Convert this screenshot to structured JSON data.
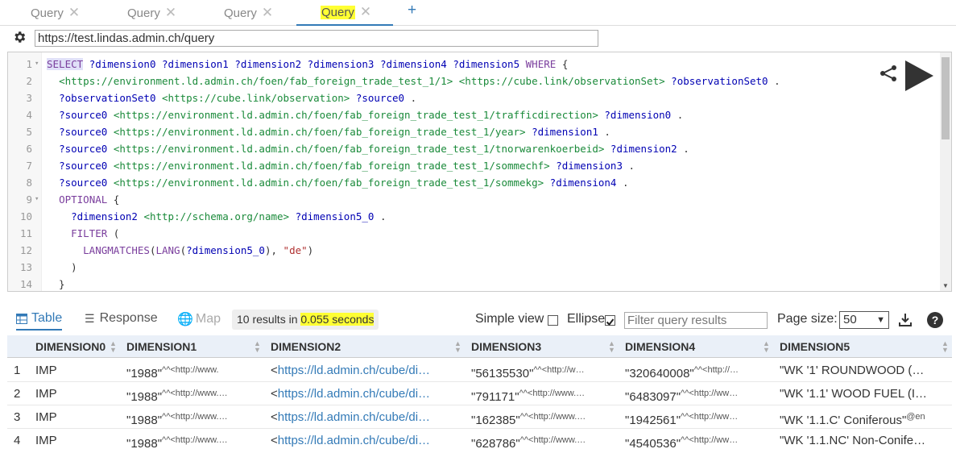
{
  "tabs": [
    {
      "label": "Query",
      "active": false
    },
    {
      "label": "Query",
      "active": false
    },
    {
      "label": "Query",
      "active": false
    },
    {
      "label": "Query",
      "active": true
    }
  ],
  "add_tab_label": "+",
  "endpoint_url": "https://test.lindas.admin.ch/query",
  "editor": {
    "lines": [
      {
        "n": "1",
        "fold": "▾",
        "text": "SELECT ?dimension0 ?dimension1 ?dimension2 ?dimension3 ?dimension4 ?dimension5 WHERE {"
      },
      {
        "n": "2",
        "fold": "",
        "text": "  <https://environment.ld.admin.ch/foen/fab_foreign_trade_test_1/1> <https://cube.link/observationSet> ?observationSet0 ."
      },
      {
        "n": "3",
        "fold": "",
        "text": "  ?observationSet0 <https://cube.link/observation> ?source0 ."
      },
      {
        "n": "4",
        "fold": "",
        "text": "  ?source0 <https://environment.ld.admin.ch/foen/fab_foreign_trade_test_1/trafficdirection> ?dimension0 ."
      },
      {
        "n": "5",
        "fold": "",
        "text": "  ?source0 <https://environment.ld.admin.ch/foen/fab_foreign_trade_test_1/year> ?dimension1 ."
      },
      {
        "n": "6",
        "fold": "",
        "text": "  ?source0 <https://environment.ld.admin.ch/foen/fab_foreign_trade_test_1/tnorwarenkoerbeid> ?dimension2 ."
      },
      {
        "n": "7",
        "fold": "",
        "text": "  ?source0 <https://environment.ld.admin.ch/foen/fab_foreign_trade_test_1/sommechf> ?dimension3 ."
      },
      {
        "n": "8",
        "fold": "",
        "text": "  ?source0 <https://environment.ld.admin.ch/foen/fab_foreign_trade_test_1/sommekg> ?dimension4 ."
      },
      {
        "n": "9",
        "fold": "▾",
        "text": "  OPTIONAL {"
      },
      {
        "n": "10",
        "fold": "",
        "text": "    ?dimension2 <http://schema.org/name> ?dimension5_0 ."
      },
      {
        "n": "11",
        "fold": "",
        "text": "    FILTER ("
      },
      {
        "n": "12",
        "fold": "",
        "text": "      LANGMATCHES(LANG(?dimension5_0), \"de\")"
      },
      {
        "n": "13",
        "fold": "",
        "text": "    )"
      },
      {
        "n": "14",
        "fold": "",
        "text": "  }"
      }
    ]
  },
  "results_toolbar": {
    "table_label": "Table",
    "response_label": "Response",
    "map_label": "Map",
    "results_count_text": "10 results in ",
    "results_time_text": "0.055 seconds",
    "simple_view_label": "Simple view",
    "simple_view_checked": false,
    "ellipse_label": "Ellipse",
    "ellipse_checked": true,
    "filter_placeholder": "Filter query results",
    "page_size_label": "Page size:",
    "page_size_value": "50",
    "help_label": "?"
  },
  "table": {
    "columns": [
      "DIMENSION0",
      "DIMENSION1",
      "DIMENSION2",
      "DIMENSION3",
      "DIMENSION4",
      "DIMENSION5"
    ],
    "rows": [
      {
        "n": "1",
        "d0": "IMP",
        "d1": "\"1988\"",
        "d1s": "^^<http://www.",
        "d2": "https://ld.admin.ch/cube/di…",
        "d3": "\"56135530\"",
        "d3s": "^^<http://w…",
        "d4": "\"320640008\"",
        "d4s": "^^<http://…",
        "d5": "\"WK '1' ROUNDWOOD (…",
        "d5s": ""
      },
      {
        "n": "2",
        "d0": "IMP",
        "d1": "\"1988\"",
        "d1s": "^^<http://www.…",
        "d2": "https://ld.admin.ch/cube/di…",
        "d3": "\"791171\"",
        "d3s": "^^<http://www.…",
        "d4": "\"6483097\"",
        "d4s": "^^<http://ww…",
        "d5": "\"WK '1.1' WOOD FUEL (I…",
        "d5s": ""
      },
      {
        "n": "3",
        "d0": "IMP",
        "d1": "\"1988\"",
        "d1s": "^^<http://www.…",
        "d2": "https://ld.admin.ch/cube/di…",
        "d3": "\"162385\"",
        "d3s": "^^<http://www.…",
        "d4": "\"1942561\"",
        "d4s": "^^<http://ww…",
        "d5": "\"WK '1.1.C' Coniferous\"",
        "d5s": "@en"
      },
      {
        "n": "4",
        "d0": "IMP",
        "d1": "\"1988\"",
        "d1s": "^^<http://www.…",
        "d2": "https://ld.admin.ch/cube/di…",
        "d3": "\"628786\"",
        "d3s": "^^<http://www.…",
        "d4": "\"4540536\"",
        "d4s": "^^<http://ww…",
        "d5": "\"WK '1.1.NC' Non-Conife…",
        "d5s": ""
      }
    ]
  }
}
